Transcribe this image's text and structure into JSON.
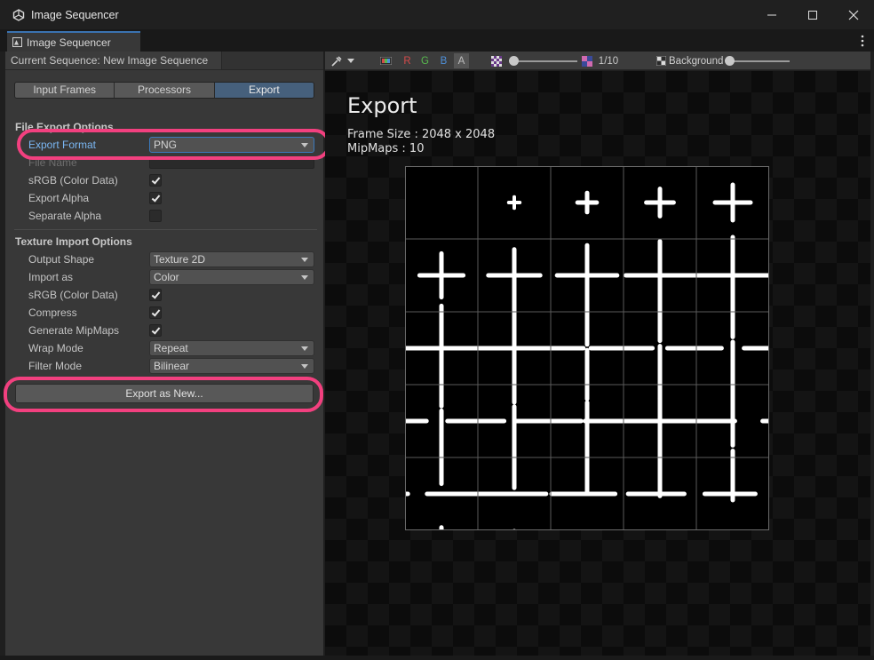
{
  "window": {
    "title": "Image Sequencer"
  },
  "tab": {
    "label": "Image Sequencer"
  },
  "sequence": {
    "label": "Current Sequence: New Image Sequence"
  },
  "mode_tabs": [
    {
      "label": "Input Frames",
      "active": false
    },
    {
      "label": "Processors",
      "active": false
    },
    {
      "label": "Export",
      "active": true
    }
  ],
  "file_export": {
    "header": "File Export Options",
    "export_format_label": "Export Format",
    "export_format_value": "PNG",
    "file_name_label": "File Name",
    "srgb_label": "sRGB (Color Data)",
    "srgb_checked": true,
    "export_alpha_label": "Export Alpha",
    "export_alpha_checked": true,
    "separate_alpha_label": "Separate Alpha",
    "separate_alpha_checked": false
  },
  "texture_import": {
    "header": "Texture Import Options",
    "output_shape_label": "Output Shape",
    "output_shape_value": "Texture 2D",
    "import_as_label": "Import as",
    "import_as_value": "Color",
    "srgb_label": "sRGB (Color Data)",
    "compress_label": "Compress",
    "mipmaps_label": "Generate MipMaps",
    "wrap_mode_label": "Wrap Mode",
    "wrap_mode_value": "Repeat",
    "filter_mode_label": "Filter Mode",
    "filter_mode_value": "Bilinear"
  },
  "export_button": {
    "label": "Export as New..."
  },
  "toolbar": {
    "channels": [
      "R",
      "G",
      "B",
      "A"
    ],
    "channel_colors": [
      "#d24a4a",
      "#57b84e",
      "#4e8fd8",
      "#bdbdbd"
    ],
    "mip_value": "1/10",
    "background_label": "Background"
  },
  "preview": {
    "title": "Export",
    "frame_size": "Frame Size : 2048 x 2048",
    "mipmaps": "MipMaps : 10",
    "grid": {
      "rows": 5,
      "cols": 5
    }
  },
  "accent_colors": {
    "highlight": "#f2407f",
    "selected_tab": "#46607c",
    "focus_label": "#7ab6f2"
  }
}
